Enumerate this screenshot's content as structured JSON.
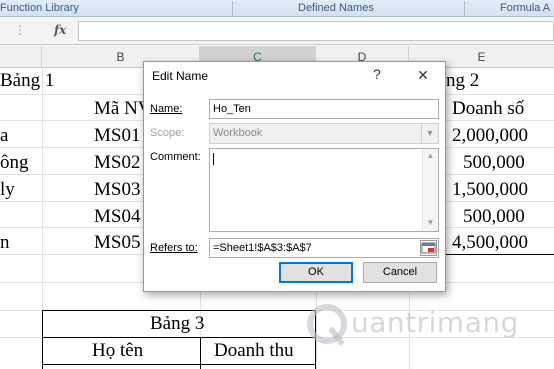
{
  "ribbon": {
    "groups": [
      "Function Library",
      "Defined Names",
      "Formula A"
    ]
  },
  "formula_bar": {
    "fx_label": "fx",
    "name_box_dots": "⋮",
    "value": ""
  },
  "columns": [
    "B",
    "C",
    "D",
    "E"
  ],
  "selected_column": "C",
  "sheet": {
    "table1": {
      "title": "Bảng 1",
      "header_partial": "Mã NV",
      "codes_partial": [
        "MS01",
        "MS02",
        "MS03",
        "MS04",
        "MS05"
      ],
      "names_partial": [
        "a",
        "ông",
        "ly",
        "",
        "n"
      ]
    },
    "table2": {
      "title_partial": "ng 2",
      "header_partial": "Doanh số",
      "sales": [
        "2,000,000",
        "500,000",
        "1,500,000",
        "500,000",
        "4,500,000"
      ]
    },
    "table3": {
      "title": "Bảng 3",
      "headers": [
        "Họ tên",
        "Doanh thu"
      ]
    }
  },
  "dialog": {
    "title": "Edit Name",
    "help_glyph": "?",
    "close_glyph": "✕",
    "name_label": "Name:",
    "name_value": "Ho_Ten",
    "scope_label": "Scope:",
    "scope_value": "Workbook",
    "comment_label": "Comment:",
    "comment_value": "",
    "refers_label": "Refers to:",
    "refers_value": "=Sheet1!$A$3:$A$7",
    "ok_label": "OK",
    "cancel_label": "Cancel"
  },
  "watermark": {
    "text": "uantrimang"
  }
}
